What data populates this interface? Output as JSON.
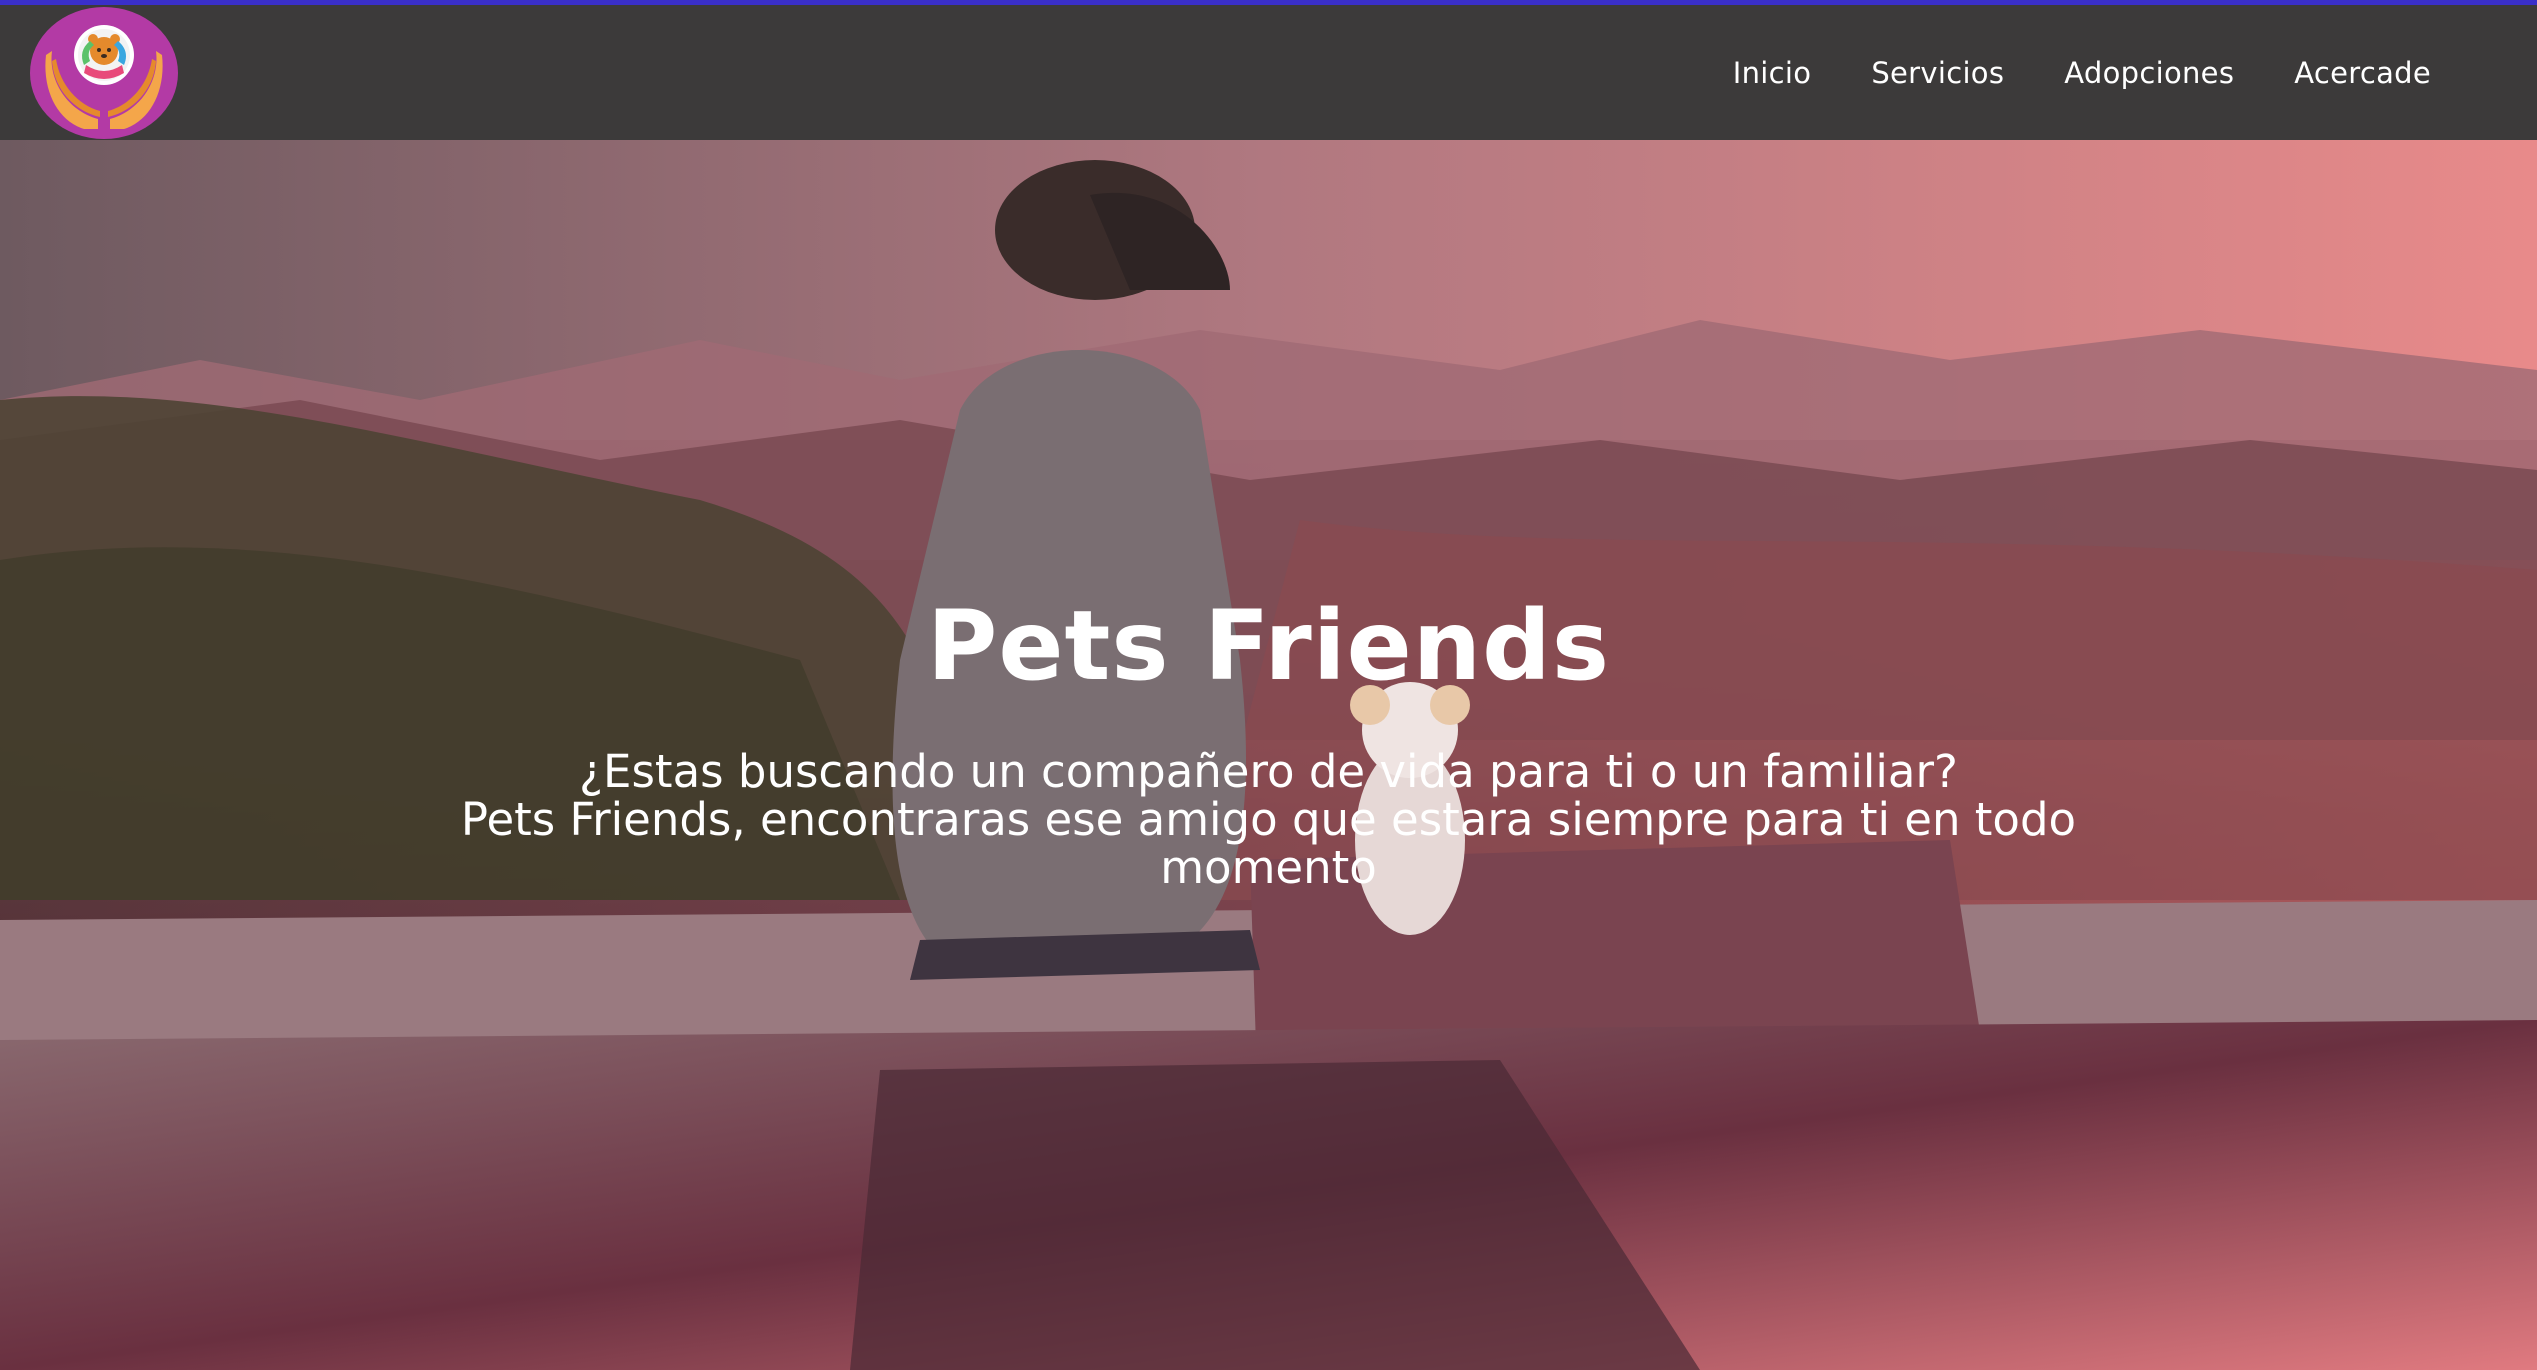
{
  "header": {
    "logo_alt": "Pets Friends logo",
    "nav": [
      {
        "label": "Inicio"
      },
      {
        "label": "Servicios"
      },
      {
        "label": "Adopciones"
      },
      {
        "label": "Acercade"
      }
    ]
  },
  "hero": {
    "title": "Pets Friends",
    "line1": "¿Estas buscando un compañero de vida para ti o un familiar?",
    "brand": "Pets Friends,",
    "line2_rest": " encontraras ese amigo que estara siempre para ti en todo momento"
  },
  "colors": {
    "navbar": "#3c3a3a",
    "accent_top": "#3a2fc9",
    "logo_ring": "#b33aa5",
    "text": "#ffffff"
  },
  "icons": {
    "logo": "hands-holding-pet-icon"
  }
}
